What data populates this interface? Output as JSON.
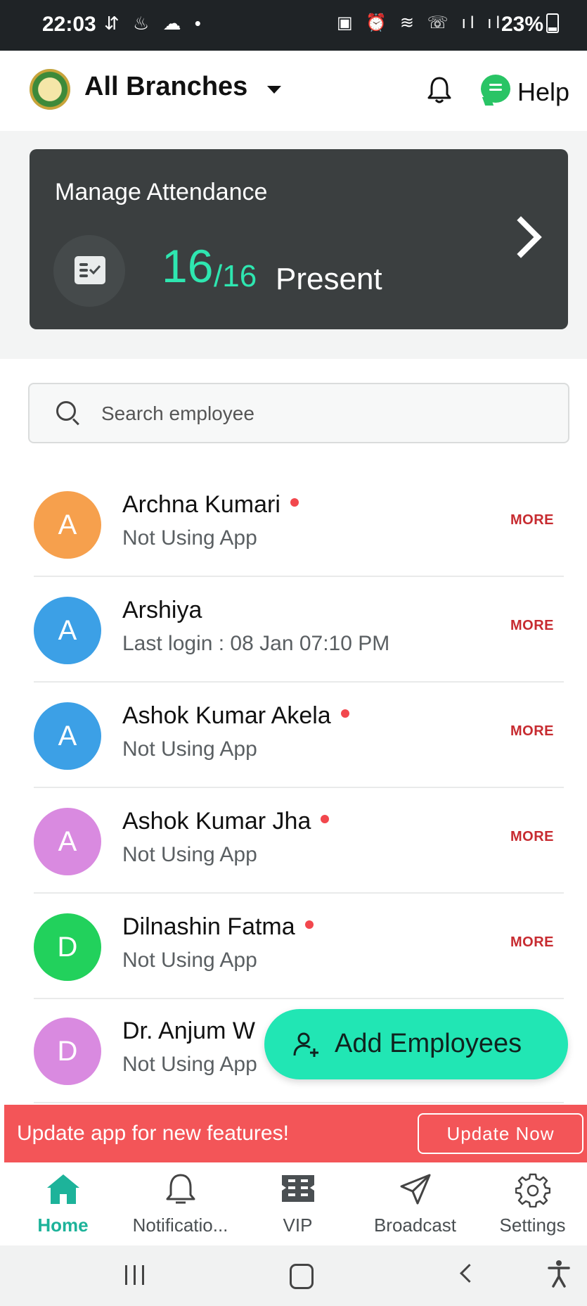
{
  "status_bar": {
    "time": "22:03",
    "left_icons": "⇵ ♨ ☁ •",
    "right_icons": "▣ ⏰ ≋ ☏ ıl ıl",
    "battery": "23%"
  },
  "header": {
    "branch_title": "All Branches",
    "help_label": "Help"
  },
  "attendance": {
    "title": "Manage Attendance",
    "present_count": "16",
    "total": "/16",
    "present_label": "Present"
  },
  "search": {
    "placeholder": "Search employee"
  },
  "employees": [
    {
      "initial": "A",
      "name": "Archna Kumari",
      "status": "Not Using App",
      "more": "MORE",
      "avatar_color": "#f6a04d",
      "dot": true
    },
    {
      "initial": "A",
      "name": "Arshiya",
      "status": "Last login : 08 Jan 07:10 PM",
      "more": "MORE",
      "avatar_color": "#3ca0e6",
      "dot": false
    },
    {
      "initial": "A",
      "name": "Ashok Kumar Akela",
      "status": "Not Using App",
      "more": "MORE",
      "avatar_color": "#3ca0e6",
      "dot": true
    },
    {
      "initial": "A",
      "name": "Ashok Kumar Jha",
      "status": "Not Using App",
      "more": "MORE",
      "avatar_color": "#d98ae0",
      "dot": true
    },
    {
      "initial": "D",
      "name": "Dilnashin Fatma",
      "status": "Not Using App",
      "more": "MORE",
      "avatar_color": "#22d15c",
      "dot": true
    },
    {
      "initial": "D",
      "name": "Dr. Anjum W",
      "status": "Not Using App",
      "more": "",
      "avatar_color": "#d98ae0",
      "dot": false
    }
  ],
  "fab": {
    "label": "Add Employees"
  },
  "banner": {
    "text": "Update app for new features!",
    "button": "Update Now"
  },
  "bottom_nav": [
    {
      "label": "Home",
      "icon": "home-icon",
      "active": true
    },
    {
      "label": "Notificatio...",
      "icon": "bell-icon",
      "active": false
    },
    {
      "label": "VIP",
      "icon": "vip-icon",
      "active": false
    },
    {
      "label": "Broadcast",
      "icon": "send-icon",
      "active": false
    },
    {
      "label": "Settings",
      "icon": "gear-icon",
      "active": false
    }
  ],
  "colors": {
    "accent": "#21e6b4",
    "card_bg": "#3b3f40",
    "banner_bg": "#f35558",
    "more_text": "#c72b30",
    "active_nav": "#1db39a"
  }
}
